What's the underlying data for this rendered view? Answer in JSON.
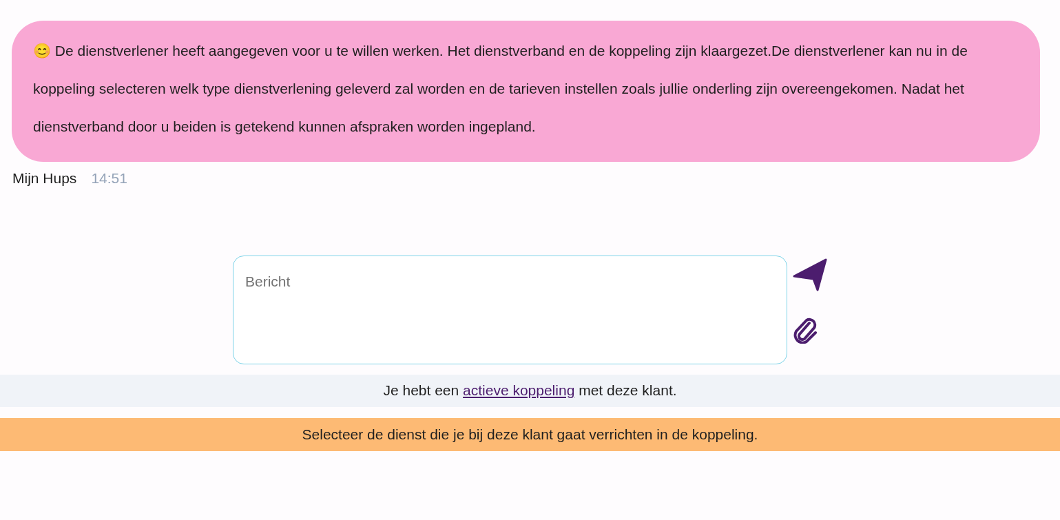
{
  "message": {
    "text": "😊 De dienstverlener heeft aangegeven voor u te willen werken. Het dienstverband en de koppeling zijn klaargezet.De dienstverlener kan nu in de koppeling selecteren welk type dienstverlening geleverd zal worden en de tarieven instellen zoals jullie onderling zijn overeengekomen. Nadat het dienstverband door u beiden is getekend kunnen afspraken worden ingepland.",
    "sender": "Mijn Hups",
    "time": "14:51"
  },
  "composer": {
    "placeholder": "Bericht"
  },
  "link_notice": {
    "before": "Je hebt een",
    "link": "actieve koppeling",
    "after": "met deze klant."
  },
  "warning": "Selecteer de dienst die je bij deze klant gaat verrichten in de koppeling."
}
